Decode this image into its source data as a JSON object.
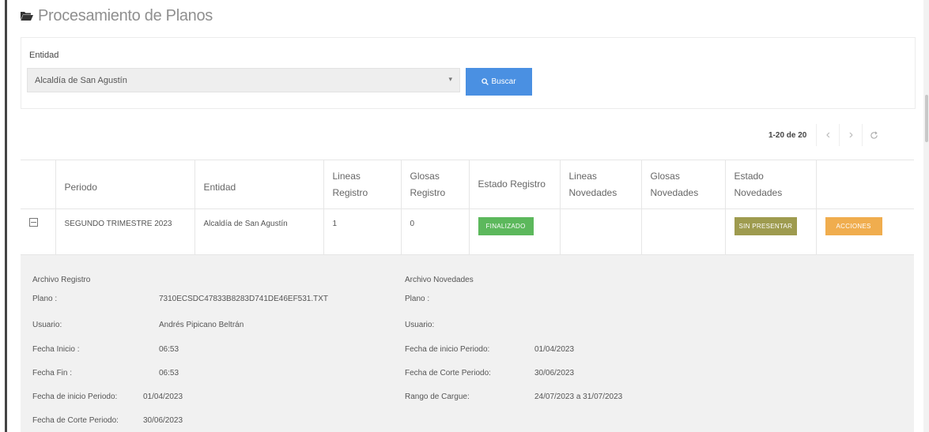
{
  "header": {
    "title": "Procesamiento de Planos",
    "icon": "folder-open-icon"
  },
  "filter": {
    "label": "Entidad",
    "selected": "Alcaldía de San Agustín",
    "search_label": "Buscar"
  },
  "pagination": {
    "range": "1-20 de 20"
  },
  "table": {
    "columns": [
      "",
      "Periodo",
      "Entidad",
      "Lineas Registro",
      "Glosas Registro",
      "Estado Registro",
      "Lineas Novedades",
      "Glosas Novedades",
      "Estado Novedades",
      ""
    ],
    "rows": [
      {
        "periodo": "SEGUNDO TRIMESTRE 2023",
        "entidad": "Alcaldía de San Agustín",
        "lineas_registro": "1",
        "glosas_registro": "0",
        "estado_registro": "FINALIZADO",
        "lineas_novedades": "",
        "glosas_novedades": "",
        "estado_novedades": "SIN PRESENTAR",
        "accion": "Acciones"
      }
    ]
  },
  "detail": {
    "registro": {
      "title": "Archivo Registro",
      "plano_label": "Plano :",
      "plano_value": "7310ECSDC47833B8283D741DE46EF531.TXT",
      "usuario_label": "Usuario:",
      "usuario_value": "Andrés Pipicano Beltrán",
      "fecha_inicio_label": "Fecha Inicio :",
      "fecha_inicio_value": "06:53",
      "fecha_fin_label": "Fecha Fin :",
      "fecha_fin_value": "06:53",
      "fecha_inicio_periodo_label": "Fecha de inicio Periodo:",
      "fecha_inicio_periodo_value": "01/04/2023",
      "fecha_corte_periodo_label": "Fecha de Corte Periodo:",
      "fecha_corte_periodo_value": "30/06/2023"
    },
    "novedades": {
      "title": "Archivo Novedades",
      "plano_label": "Plano :",
      "usuario_label": "Usuario:",
      "fecha_inicio_periodo_label": "Fecha de inicio Periodo:",
      "fecha_inicio_periodo_value": "01/04/2023",
      "fecha_corte_periodo_label": "Fecha de Corte Periodo:",
      "fecha_corte_periodo_value": "30/06/2023",
      "rango_label": "Rango de Cargue:",
      "rango_value": "24/07/2023 a 31/07/2023"
    }
  },
  "colors": {
    "primary": "#4a90e2",
    "success": "#5cb85c",
    "olive": "#9e9b4f",
    "warning": "#f0ad4e"
  }
}
